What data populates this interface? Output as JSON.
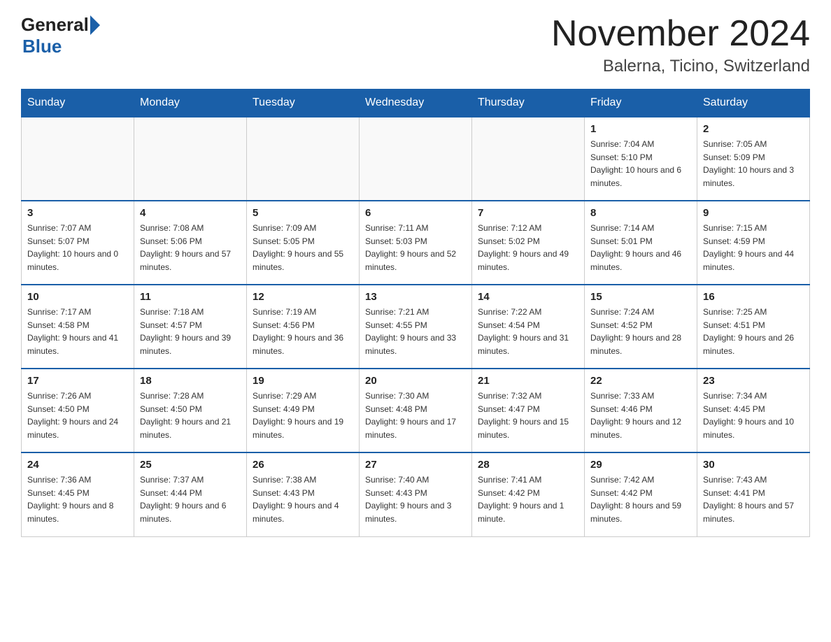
{
  "logo": {
    "general": "General",
    "blue": "Blue"
  },
  "header": {
    "month_year": "November 2024",
    "location": "Balerna, Ticino, Switzerland"
  },
  "days_of_week": [
    "Sunday",
    "Monday",
    "Tuesday",
    "Wednesday",
    "Thursday",
    "Friday",
    "Saturday"
  ],
  "weeks": [
    [
      {
        "day": "",
        "info": ""
      },
      {
        "day": "",
        "info": ""
      },
      {
        "day": "",
        "info": ""
      },
      {
        "day": "",
        "info": ""
      },
      {
        "day": "",
        "info": ""
      },
      {
        "day": "1",
        "info": "Sunrise: 7:04 AM\nSunset: 5:10 PM\nDaylight: 10 hours and 6 minutes."
      },
      {
        "day": "2",
        "info": "Sunrise: 7:05 AM\nSunset: 5:09 PM\nDaylight: 10 hours and 3 minutes."
      }
    ],
    [
      {
        "day": "3",
        "info": "Sunrise: 7:07 AM\nSunset: 5:07 PM\nDaylight: 10 hours and 0 minutes."
      },
      {
        "day": "4",
        "info": "Sunrise: 7:08 AM\nSunset: 5:06 PM\nDaylight: 9 hours and 57 minutes."
      },
      {
        "day": "5",
        "info": "Sunrise: 7:09 AM\nSunset: 5:05 PM\nDaylight: 9 hours and 55 minutes."
      },
      {
        "day": "6",
        "info": "Sunrise: 7:11 AM\nSunset: 5:03 PM\nDaylight: 9 hours and 52 minutes."
      },
      {
        "day": "7",
        "info": "Sunrise: 7:12 AM\nSunset: 5:02 PM\nDaylight: 9 hours and 49 minutes."
      },
      {
        "day": "8",
        "info": "Sunrise: 7:14 AM\nSunset: 5:01 PM\nDaylight: 9 hours and 46 minutes."
      },
      {
        "day": "9",
        "info": "Sunrise: 7:15 AM\nSunset: 4:59 PM\nDaylight: 9 hours and 44 minutes."
      }
    ],
    [
      {
        "day": "10",
        "info": "Sunrise: 7:17 AM\nSunset: 4:58 PM\nDaylight: 9 hours and 41 minutes."
      },
      {
        "day": "11",
        "info": "Sunrise: 7:18 AM\nSunset: 4:57 PM\nDaylight: 9 hours and 39 minutes."
      },
      {
        "day": "12",
        "info": "Sunrise: 7:19 AM\nSunset: 4:56 PM\nDaylight: 9 hours and 36 minutes."
      },
      {
        "day": "13",
        "info": "Sunrise: 7:21 AM\nSunset: 4:55 PM\nDaylight: 9 hours and 33 minutes."
      },
      {
        "day": "14",
        "info": "Sunrise: 7:22 AM\nSunset: 4:54 PM\nDaylight: 9 hours and 31 minutes."
      },
      {
        "day": "15",
        "info": "Sunrise: 7:24 AM\nSunset: 4:52 PM\nDaylight: 9 hours and 28 minutes."
      },
      {
        "day": "16",
        "info": "Sunrise: 7:25 AM\nSunset: 4:51 PM\nDaylight: 9 hours and 26 minutes."
      }
    ],
    [
      {
        "day": "17",
        "info": "Sunrise: 7:26 AM\nSunset: 4:50 PM\nDaylight: 9 hours and 24 minutes."
      },
      {
        "day": "18",
        "info": "Sunrise: 7:28 AM\nSunset: 4:50 PM\nDaylight: 9 hours and 21 minutes."
      },
      {
        "day": "19",
        "info": "Sunrise: 7:29 AM\nSunset: 4:49 PM\nDaylight: 9 hours and 19 minutes."
      },
      {
        "day": "20",
        "info": "Sunrise: 7:30 AM\nSunset: 4:48 PM\nDaylight: 9 hours and 17 minutes."
      },
      {
        "day": "21",
        "info": "Sunrise: 7:32 AM\nSunset: 4:47 PM\nDaylight: 9 hours and 15 minutes."
      },
      {
        "day": "22",
        "info": "Sunrise: 7:33 AM\nSunset: 4:46 PM\nDaylight: 9 hours and 12 minutes."
      },
      {
        "day": "23",
        "info": "Sunrise: 7:34 AM\nSunset: 4:45 PM\nDaylight: 9 hours and 10 minutes."
      }
    ],
    [
      {
        "day": "24",
        "info": "Sunrise: 7:36 AM\nSunset: 4:45 PM\nDaylight: 9 hours and 8 minutes."
      },
      {
        "day": "25",
        "info": "Sunrise: 7:37 AM\nSunset: 4:44 PM\nDaylight: 9 hours and 6 minutes."
      },
      {
        "day": "26",
        "info": "Sunrise: 7:38 AM\nSunset: 4:43 PM\nDaylight: 9 hours and 4 minutes."
      },
      {
        "day": "27",
        "info": "Sunrise: 7:40 AM\nSunset: 4:43 PM\nDaylight: 9 hours and 3 minutes."
      },
      {
        "day": "28",
        "info": "Sunrise: 7:41 AM\nSunset: 4:42 PM\nDaylight: 9 hours and 1 minute."
      },
      {
        "day": "29",
        "info": "Sunrise: 7:42 AM\nSunset: 4:42 PM\nDaylight: 8 hours and 59 minutes."
      },
      {
        "day": "30",
        "info": "Sunrise: 7:43 AM\nSunset: 4:41 PM\nDaylight: 8 hours and 57 minutes."
      }
    ]
  ]
}
